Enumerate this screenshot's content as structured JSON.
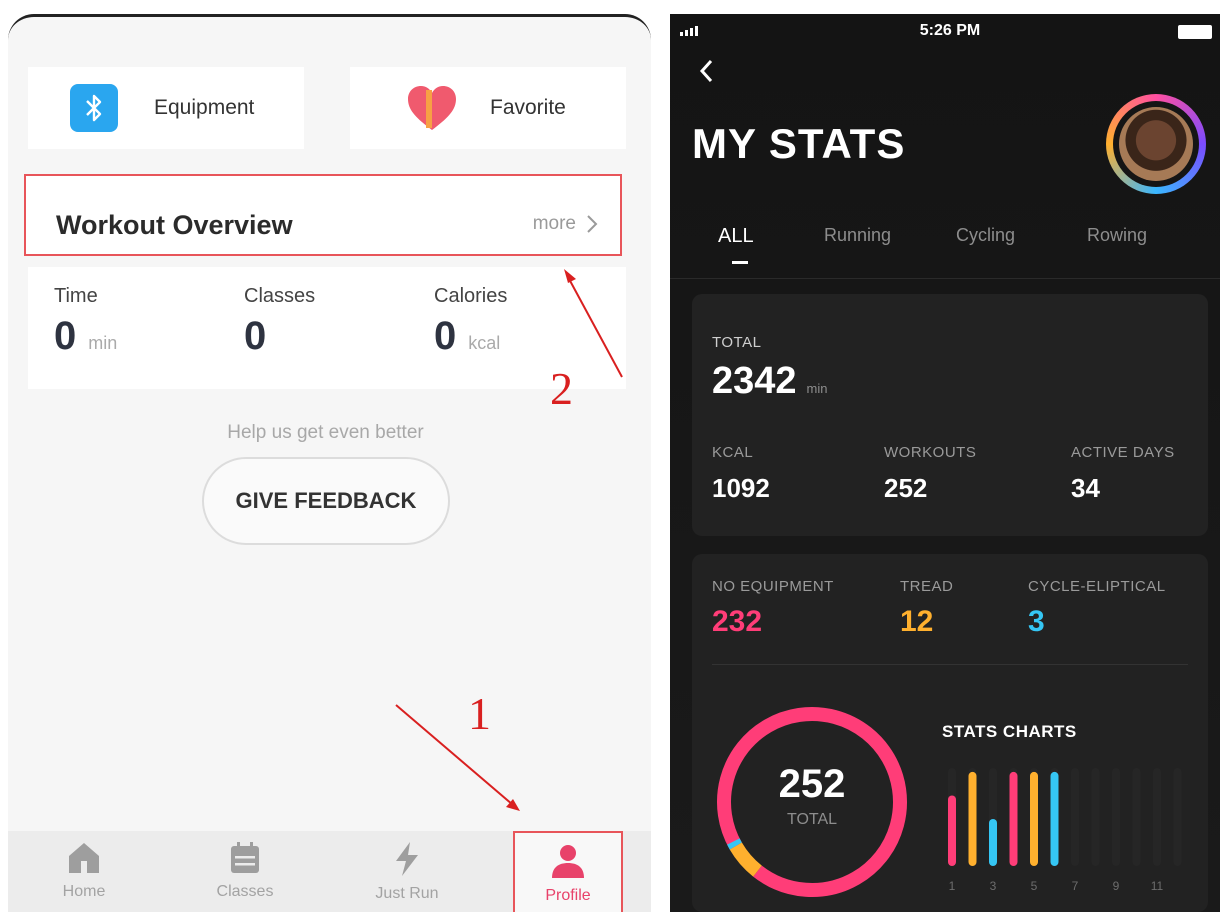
{
  "left": {
    "quick_links": {
      "equipment_label": "Equipment",
      "favorite_label": "Favorite"
    },
    "overview": {
      "title": "Workout Overview",
      "more_label": "more"
    },
    "stats": [
      {
        "label": "Time",
        "value": "0",
        "unit": "min"
      },
      {
        "label": "Classes",
        "value": "0",
        "unit": ""
      },
      {
        "label": "Calories",
        "value": "0",
        "unit": "kcal"
      }
    ],
    "help_text": "Help us get even better",
    "feedback_label": "GIVE FEEDBACK",
    "annotations": {
      "one": "1",
      "two": "2"
    },
    "tabbar": [
      {
        "label": "Home",
        "icon": "home-icon"
      },
      {
        "label": "Classes",
        "icon": "calendar-icon"
      },
      {
        "label": "Just Run",
        "icon": "lightning-icon"
      },
      {
        "label": "Profile",
        "icon": "user-icon",
        "active": true
      }
    ],
    "colors": {
      "accent": "#e8426a",
      "bluetooth": "#2aa6ef",
      "highlight_box": "#e8555a"
    }
  },
  "right": {
    "status_time": "5:26 PM",
    "title": "MY STATS",
    "tabs": [
      "ALL",
      "Running",
      "Cycling",
      "Rowing"
    ],
    "active_tab": "ALL",
    "total": {
      "label": "TOTAL",
      "value": "2342",
      "unit": "min"
    },
    "metrics": [
      {
        "label": "KCAL",
        "value": "1092"
      },
      {
        "label": "WORKOUTS",
        "value": "252"
      },
      {
        "label": "ACTIVE DAYS",
        "value": "34"
      }
    ],
    "equipment": [
      {
        "label": "NO EQUIPMENT",
        "value": "232",
        "color": "#ff3d78"
      },
      {
        "label": "TREAD",
        "value": "12",
        "color": "#ffb02e"
      },
      {
        "label": "CYCLE-ELIPTICAL",
        "value": "3",
        "color": "#35c6f4"
      }
    ],
    "donut": {
      "value": "252",
      "label": "TOTAL"
    },
    "stats_charts_title": "STATS CHARTS",
    "chart_ticks": [
      "1",
      "3",
      "5",
      "7",
      "9",
      "11"
    ],
    "chart_bars": [
      0.72,
      0.96,
      0.48,
      0.96,
      0.96,
      0.96,
      0,
      0,
      0,
      0,
      0,
      0
    ]
  }
}
